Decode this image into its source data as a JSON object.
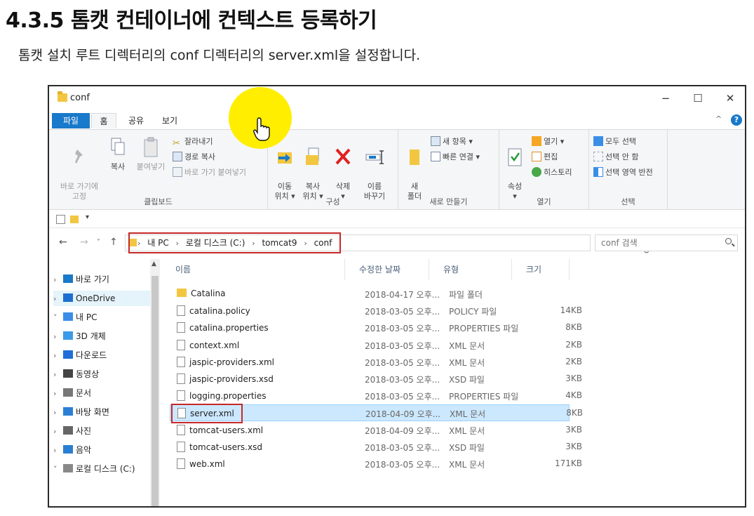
{
  "slide": {
    "title": "4.3.5 톰캣 컨테이너에 컨텍스트 등록하기",
    "subtitle": "톰캣 설치 루트 디렉터리의 conf 디렉터리의 server.xml을 설정합니다."
  },
  "window": {
    "title": "conf",
    "minimize": "−",
    "maximize": "☐",
    "close": "✕"
  },
  "ribbon": {
    "tabs": [
      "파일",
      "홈",
      "공유",
      "보기"
    ],
    "collapse": "^",
    "help": "?",
    "clipboard": {
      "label": "클립보드",
      "pin": "바로 가기에\n고정",
      "copy": "복사",
      "paste": "붙여넣기",
      "cut": "잘라내기",
      "copy_path": "경로 복사",
      "paste_shortcut": "바로 가기 붙여넣기"
    },
    "organize": {
      "label": "구성",
      "move": "이동\n위치 ▾",
      "copy_to": "복사\n위치 ▾",
      "delete": "삭제\n▾",
      "rename": "이름\n바꾸기"
    },
    "new": {
      "label": "새로 만들기",
      "new_folder": "새\n폴더",
      "new_item": "새 항목 ▾",
      "easy_access": "빠른 연결 ▾"
    },
    "open": {
      "label": "열기",
      "properties": "속성\n▾",
      "open": "열기 ▾",
      "edit": "편집",
      "history": "히스토리"
    },
    "select": {
      "label": "선택",
      "select_all": "모두 선택",
      "select_none": "선택 안 함",
      "invert": "선택 영역 반전"
    }
  },
  "quick_access": {
    "dropdown": "▾"
  },
  "address": {
    "back": "←",
    "forward": "→",
    "history": "˅",
    "up": "↑",
    "crumbs": [
      "내 PC",
      "로컬 디스크 (C:)",
      "tomcat9",
      "conf"
    ],
    "separator": "›",
    "lead": "›",
    "dropdown": "˅",
    "refresh": "↻",
    "search_placeholder": "conf 검색"
  },
  "nav_pane": [
    {
      "chev": "›",
      "label": "바로 가기",
      "icon": "star-icon",
      "color": "#1979ca"
    },
    {
      "chev": "›",
      "label": "OneDrive",
      "icon": "cloud-icon",
      "color": "#1c6fd1"
    },
    {
      "chev": "˅",
      "label": "내 PC",
      "icon": "computer-icon",
      "color": "#3a8ee6"
    },
    {
      "chev": "›",
      "label": "3D 개체",
      "icon": "cube-icon",
      "color": "#3c9be8"
    },
    {
      "chev": "›",
      "label": "다운로드",
      "icon": "download-icon",
      "color": "#1e6fd9"
    },
    {
      "chev": "›",
      "label": "동영상",
      "icon": "video-icon",
      "color": "#444444"
    },
    {
      "chev": "›",
      "label": "문서",
      "icon": "document-icon",
      "color": "#777777"
    },
    {
      "chev": "›",
      "label": "바탕 화면",
      "icon": "desktop-icon",
      "color": "#2a7fd4"
    },
    {
      "chev": "›",
      "label": "사진",
      "icon": "picture-icon",
      "color": "#666666"
    },
    {
      "chev": "›",
      "label": "음악",
      "icon": "music-icon",
      "color": "#2a7fd4"
    },
    {
      "chev": "˅",
      "label": "로컬 디스크 (C:)",
      "icon": "drive-icon",
      "color": "#888888"
    }
  ],
  "columns": [
    "이름",
    "수정한 날짜",
    "유형",
    "크기"
  ],
  "files": [
    {
      "name": "Catalina",
      "date": "2018-04-17 오후...",
      "type": "파일 폴더",
      "size": "",
      "kind": "folder"
    },
    {
      "name": "catalina.policy",
      "date": "2018-03-05 오후...",
      "type": "POLICY 파일",
      "size": "14KB",
      "kind": "file"
    },
    {
      "name": "catalina.properties",
      "date": "2018-03-05 오후...",
      "type": "PROPERTIES 파일",
      "size": "8KB",
      "kind": "file"
    },
    {
      "name": "context.xml",
      "date": "2018-03-05 오후...",
      "type": "XML 문서",
      "size": "2KB",
      "kind": "file"
    },
    {
      "name": "jaspic-providers.xml",
      "date": "2018-03-05 오후...",
      "type": "XML 문서",
      "size": "2KB",
      "kind": "file"
    },
    {
      "name": "jaspic-providers.xsd",
      "date": "2018-03-05 오후...",
      "type": "XSD 파일",
      "size": "3KB",
      "kind": "file"
    },
    {
      "name": "logging.properties",
      "date": "2018-03-05 오후...",
      "type": "PROPERTIES 파일",
      "size": "4KB",
      "kind": "file"
    },
    {
      "name": "server.xml",
      "date": "2018-04-09 오후...",
      "type": "XML 문서",
      "size": "8KB",
      "kind": "file",
      "selected": true
    },
    {
      "name": "tomcat-users.xml",
      "date": "2018-04-09 오후...",
      "type": "XML 문서",
      "size": "3KB",
      "kind": "file"
    },
    {
      "name": "tomcat-users.xsd",
      "date": "2018-03-05 오후...",
      "type": "XSD 파일",
      "size": "3KB",
      "kind": "file"
    },
    {
      "name": "web.xml",
      "date": "2018-03-05 오후...",
      "type": "XML 문서",
      "size": "171KB",
      "kind": "file"
    }
  ],
  "colors": {
    "accent": "#1979ca",
    "highlight_box": "#c62828",
    "selection": "#cce8ff",
    "cursor_glow": "#ffee00",
    "folder": "#f2c641"
  }
}
